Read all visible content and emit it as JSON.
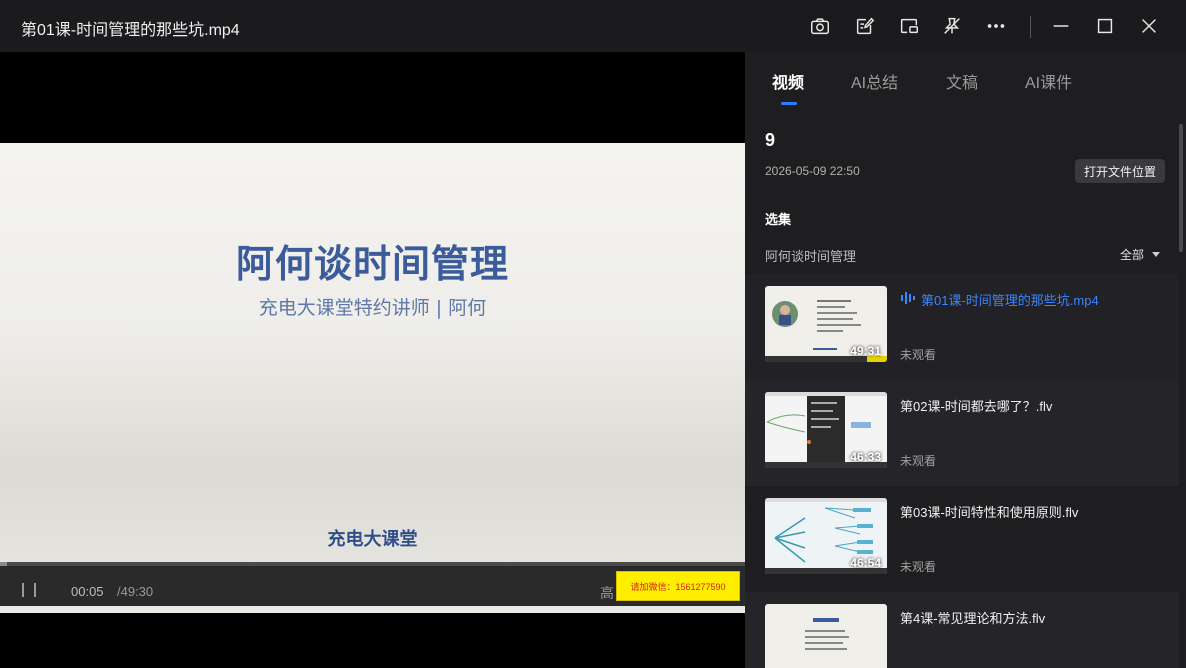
{
  "window": {
    "title": "第01课-时间管理的那些坑.mp4",
    "icons": [
      "camera-icon",
      "note-edit-icon",
      "picture-in-picture-icon",
      "mute-pin-icon",
      "more-icon",
      "minimize-icon",
      "maximize-icon",
      "close-icon"
    ]
  },
  "video": {
    "slide_title": "阿何谈时间管理",
    "slide_subtitle": "充电大课堂特约讲师 | 阿何",
    "slide_footer": "充电大课堂",
    "current_time": "00:05",
    "total_time": "/49:30",
    "quality": "高",
    "ad_text": "请加微信：1561277590",
    "progress_fraction": 0.002
  },
  "panel": {
    "tabs": [
      {
        "label": "视频",
        "active": true
      },
      {
        "label": "AI总结",
        "active": false
      },
      {
        "label": "文稿",
        "active": false
      },
      {
        "label": "AI课件",
        "active": false
      }
    ],
    "name": "9",
    "date": "2026-05-09 22:50",
    "open_location_label": "打开文件位置",
    "selection_label": "选集",
    "course_label": "阿何谈时间管理",
    "filter_label": "全部",
    "episodes": [
      {
        "title": "第01课-时间管理的那些坑.mp4",
        "duration": "49:31",
        "status": "未观看",
        "playing": true
      },
      {
        "title": "第02课-时间都去哪了？.flv",
        "duration": "46:33",
        "status": "未观看",
        "playing": false
      },
      {
        "title": "第03课-时间特性和使用原则.flv",
        "duration": "46:54",
        "status": "未观看",
        "playing": false
      },
      {
        "title": "第4课-常见理论和方法.flv",
        "duration": "",
        "status": "",
        "playing": false
      }
    ],
    "accent_color": "#2f7bff"
  }
}
